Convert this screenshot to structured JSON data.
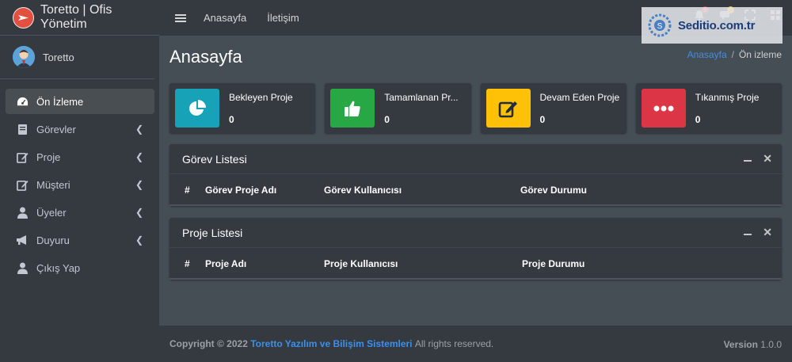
{
  "brand": {
    "title": "Toretto | Ofis Yönetim"
  },
  "user": {
    "name": "Toretto"
  },
  "sidebar": {
    "items": [
      {
        "label": "Ön İzleme",
        "icon": "dashboard-icon",
        "active": true
      },
      {
        "label": "Görevler",
        "icon": "book-icon"
      },
      {
        "label": "Proje",
        "icon": "edit-icon"
      },
      {
        "label": "Müşteri",
        "icon": "edit-icon"
      },
      {
        "label": "Üyeler",
        "icon": "user-icon"
      },
      {
        "label": "Duyuru",
        "icon": "megaphone-icon"
      },
      {
        "label": "Çıkış Yap",
        "icon": "user-icon"
      }
    ]
  },
  "navbar": {
    "links": [
      "Anasayfa",
      "İletişim"
    ],
    "notifications_badge": "0",
    "watermark": "Seditio.com.tr"
  },
  "page": {
    "title": "Anasayfa",
    "breadcrumb": {
      "home": "Anasayfa",
      "current": "Ön izleme"
    }
  },
  "infoboxes": [
    {
      "label": "Bekleyen Proje",
      "value": "0",
      "color": "#17a2b8",
      "icon": "pie-chart-icon"
    },
    {
      "label": "Tamamlanan Pr...",
      "value": "0",
      "color": "#28a745",
      "icon": "thumbs-up-icon"
    },
    {
      "label": "Devam Eden Proje",
      "value": "0",
      "color": "#ffc107",
      "icon": "edit-icon"
    },
    {
      "label": "Tıkanmış Proje",
      "value": "0",
      "color": "#dc3545",
      "icon": "ellipsis-icon"
    }
  ],
  "task_card": {
    "title": "Görev Listesi",
    "columns": [
      "#",
      "Görev Proje Adı",
      "Görev Kullanıcısı",
      "Görev Durumu"
    ]
  },
  "project_card": {
    "title": "Proje Listesi",
    "columns": [
      "#",
      "Proje Adı",
      "Proje Kullanıcısı",
      "Proje Durumu"
    ]
  },
  "footer": {
    "copyright": "Copyright © 2022",
    "company": "Toretto Yazılım ve Bilişim Sistemleri",
    "rights": "All rights reserved.",
    "version_label": "Version",
    "version_number": "1.0.0"
  }
}
